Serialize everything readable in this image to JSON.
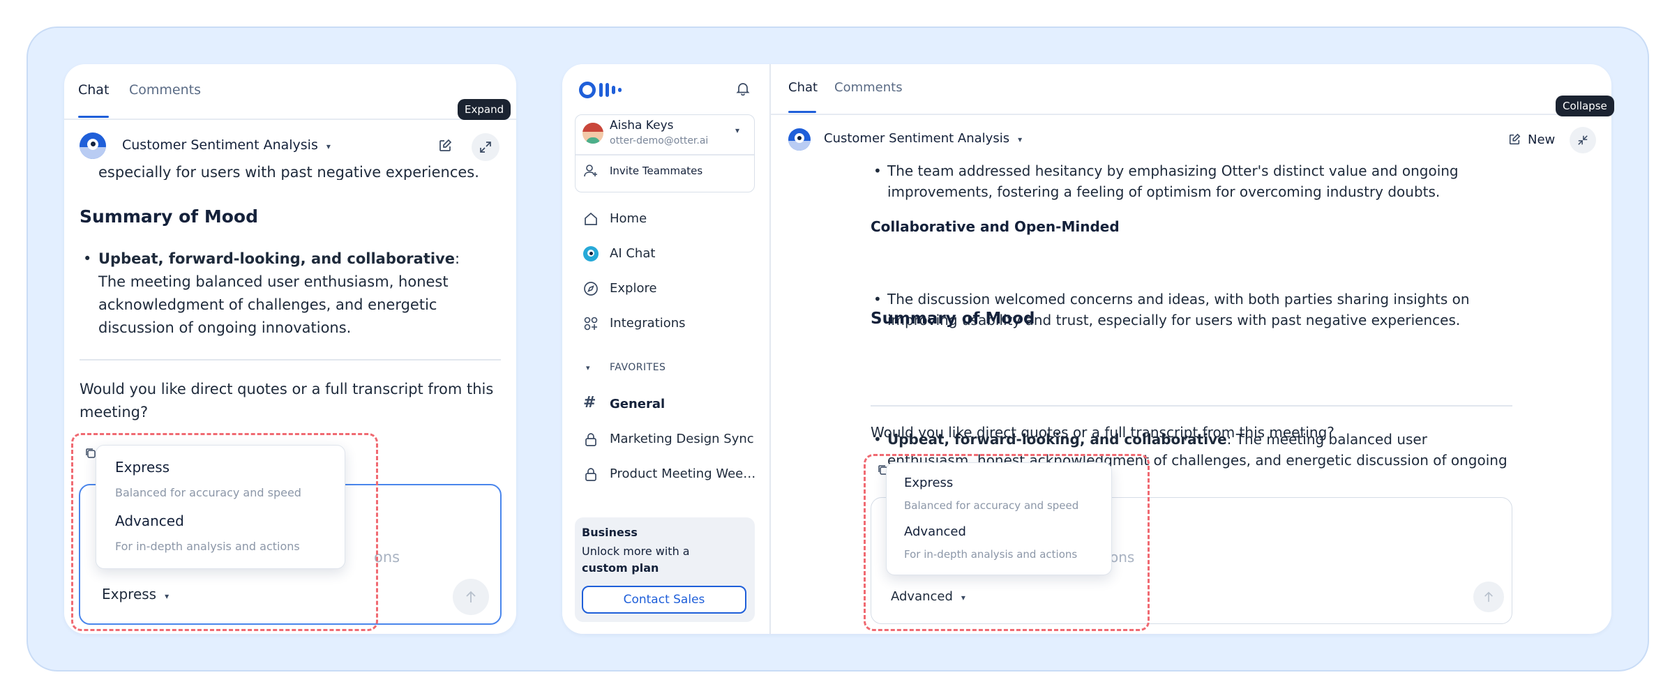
{
  "left": {
    "tabs": [
      {
        "label": "Chat"
      },
      {
        "label": "Comments"
      }
    ],
    "header": {
      "title": "Customer Sentiment Analysis",
      "tooltip": "Expand"
    },
    "content": {
      "cut_line": "especially for users with past negative experiences.",
      "heading": "Summary of Mood",
      "bullet_bold": "Upbeat, forward-looking, and collaborative",
      "bullet_rest": ": The meeting balanced user enthusiasm, honest acknowledgment of challenges, and energetic discussion of ongoing innovations.",
      "question": "Would you like direct quotes or a full transcript from this meeting?"
    },
    "input": {
      "placeholder_tail": "ons",
      "model": "Express"
    },
    "menu": [
      {
        "title": "Express",
        "desc": "Balanced for accuracy and speed"
      },
      {
        "title": "Advanced",
        "desc": "For in-depth analysis and actions"
      }
    ]
  },
  "sidebar": {
    "user": {
      "name": "Aisha Keys",
      "email": "otter-demo@otter.ai"
    },
    "invite": "Invite Teammates",
    "nav": [
      {
        "label": "Home"
      },
      {
        "label": "AI Chat"
      },
      {
        "label": "Explore"
      },
      {
        "label": "Integrations"
      }
    ],
    "favorites_label": "FAVORITES",
    "favorites": [
      {
        "label": "General"
      },
      {
        "label": "Marketing Design Sync"
      },
      {
        "label": "Product Meeting Wee…"
      }
    ],
    "promo": {
      "title": "Business",
      "line1": "Unlock more with a",
      "line2": "custom plan",
      "cta": "Contact Sales"
    }
  },
  "right": {
    "tabs": [
      {
        "label": "Chat"
      },
      {
        "label": "Comments"
      }
    ],
    "header": {
      "title": "Customer Sentiment Analysis",
      "new_label": "New",
      "tooltip": "Collapse"
    },
    "content": {
      "bullet1": "The team addressed hesitancy by emphasizing Otter's distinct value and ongoing improvements, fostering a feeling of optimism for overcoming industry doubts.",
      "subheading": "Collaborative and Open-Minded",
      "bullet2": "The discussion welcomed concerns and ideas, with both parties sharing insights on improving usability and trust, especially for users with past negative experiences.",
      "heading": "Summary of Mood",
      "bullet3_bold": "Upbeat, forward-looking, and collaborative",
      "bullet3_rest": ": The meeting balanced user enthusiasm, honest acknowledgment of challenges, and energetic discussion of ongoing innovations.",
      "question": "Would you like direct quotes or a full transcript from this meeting?"
    },
    "input": {
      "placeholder_tail": "ons",
      "model": "Advanced"
    },
    "menu": [
      {
        "title": "Express",
        "desc": "Balanced for accuracy and speed"
      },
      {
        "title": "Advanced",
        "desc": "For in-depth analysis and actions"
      }
    ]
  },
  "colors": {
    "accent": "#1f5fd9",
    "dashed": "#f06a72",
    "frame_bg": "#e3efff"
  }
}
